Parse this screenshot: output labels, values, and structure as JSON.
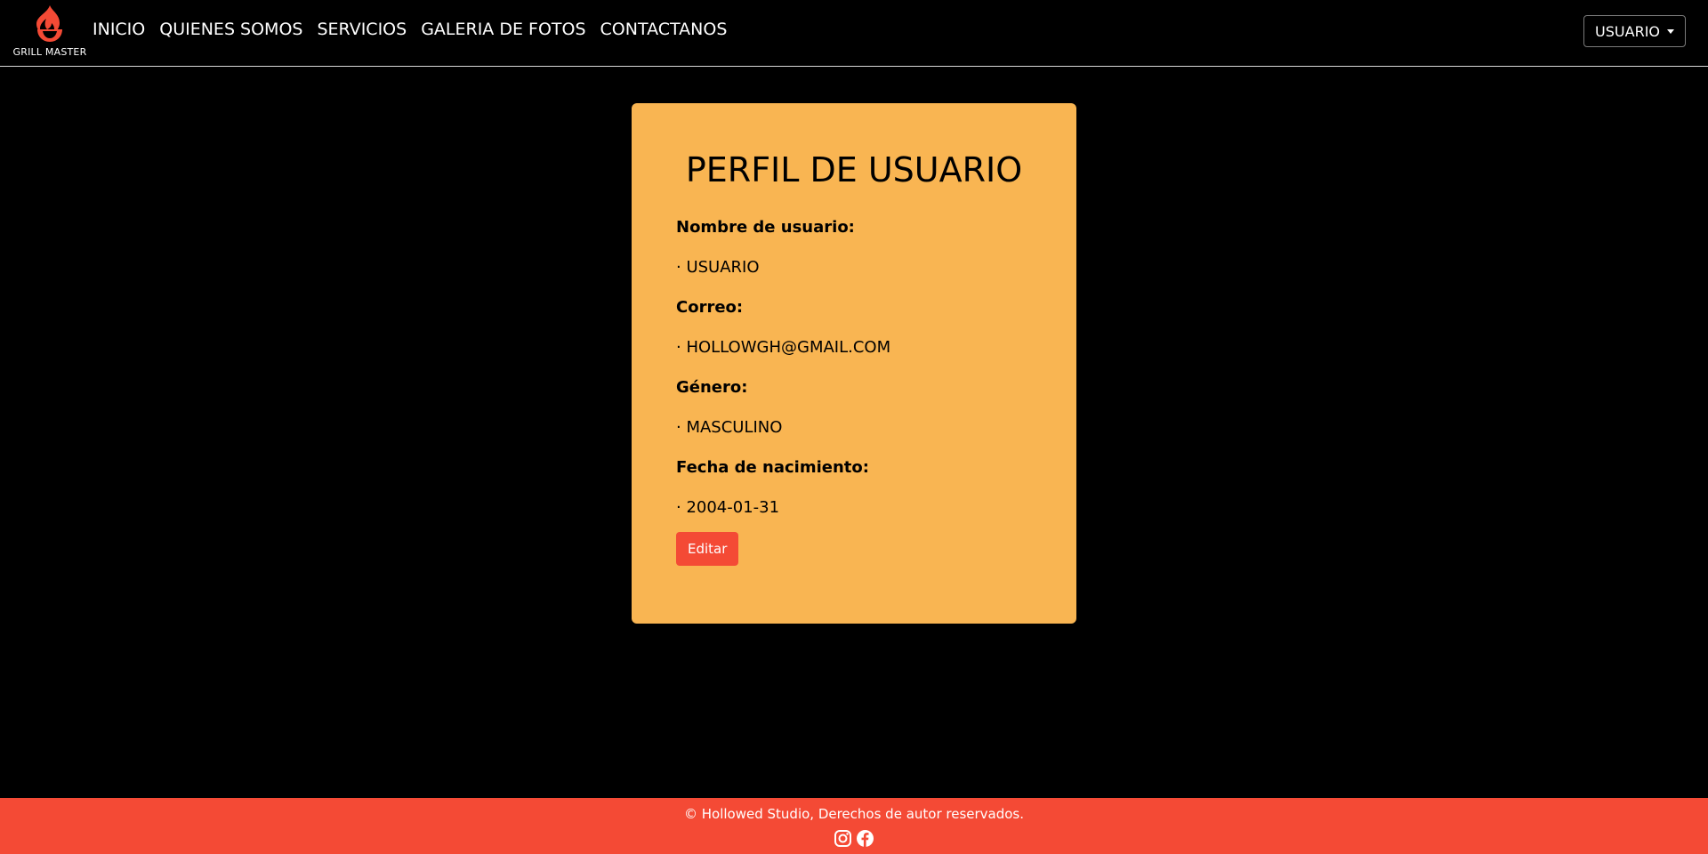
{
  "brand": {
    "name": "GRILL MASTER",
    "logo_icon": "flame-grill-icon",
    "accent_color": "#f44a35"
  },
  "nav": {
    "items": [
      {
        "label": "INICIO"
      },
      {
        "label": "QUIENES SOMOS"
      },
      {
        "label": "SERVICIOS"
      },
      {
        "label": "GALERIA DE FOTOS"
      },
      {
        "label": "CONTACTANOS"
      }
    ],
    "user_menu_label": "USUARIO",
    "user_menu_icon": "caret-down-icon"
  },
  "profile": {
    "title": "PERFIL DE USUARIO",
    "card_color": "#f9b552",
    "fields": [
      {
        "label": "Nombre de usuario:",
        "value": "· USUARIO"
      },
      {
        "label": "Correo:",
        "value": "· HOLLOWGH@GMAIL.COM"
      },
      {
        "label": "Género:",
        "value": "· MASCULINO"
      },
      {
        "label": "Fecha de nacimiento:",
        "value": "· 2004-01-31"
      }
    ],
    "edit_label": "Editar"
  },
  "footer": {
    "copyright": "© Hollowed Studio, Derechos de autor reservados.",
    "icons": [
      "instagram-icon",
      "facebook-icon"
    ]
  }
}
